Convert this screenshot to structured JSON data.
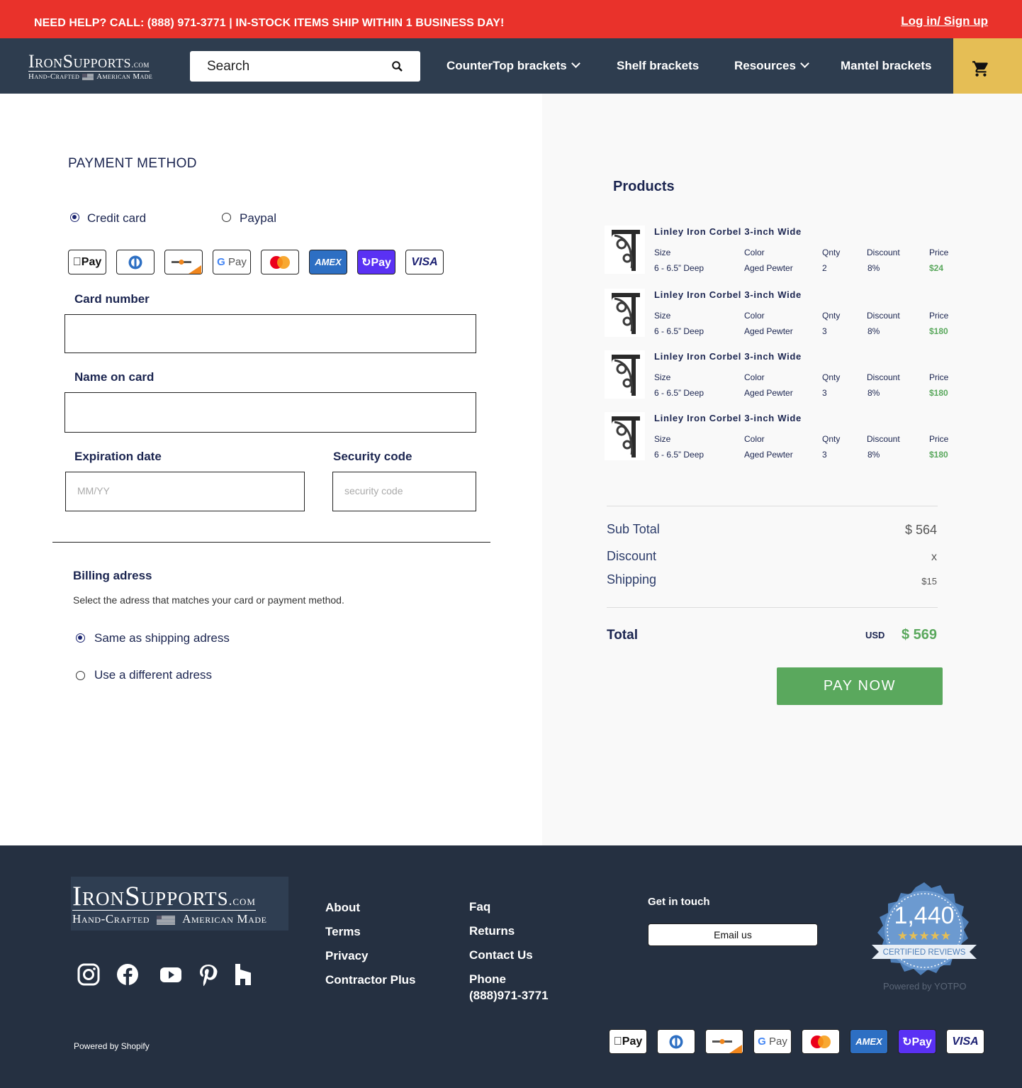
{
  "topbar": {
    "message": "NEED HELP? CALL: (888) 971-3771 | IN-STOCK ITEMS SHIP WITHIN 1 BUSINESS DAY!",
    "login": "Log in/ Sign up"
  },
  "logo": {
    "main": "IronSupports",
    "domain": ".com",
    "left": "Hand-Crafted",
    "right": "American Made"
  },
  "search": {
    "placeholder": "Search"
  },
  "nav": {
    "countertop": "CounterTop brackets",
    "shelf": "Shelf brackets",
    "resources": "Resources",
    "mantel": "Mantel brackets"
  },
  "payment": {
    "heading": "PAYMENT METHOD",
    "credit": "Credit card",
    "paypal": "Paypal",
    "selected": "Credit card",
    "cards": [
      "apple-pay-icon",
      "diners-club-icon",
      "discover-icon",
      "google-pay-icon",
      "mastercard-icon",
      "amex-icon",
      "shop-pay-icon",
      "visa-icon"
    ],
    "card_number_label": "Card number",
    "name_label": "Name on card",
    "exp_label": "Expiration date",
    "exp_placeholder": "MM/YY",
    "sec_label": "Security code",
    "sec_placeholder": "security code"
  },
  "billing": {
    "heading": "Billing adress",
    "sub": "Select the adress that matches your card or payment method.",
    "same": "Same as shipping adress",
    "different": "Use a different adress",
    "selected": "Same as shipping adress"
  },
  "products": {
    "heading": "Products",
    "headers": {
      "size": "Size",
      "color": "Color",
      "qty": "Qnty",
      "discount": "Discount",
      "price": "Price"
    },
    "items": [
      {
        "name": "Linley Iron Corbel 3-inch Wide",
        "size": "6 - 6.5” Deep",
        "color": "Aged Pewter",
        "qty": "2",
        "discount": "8%",
        "price": "$24"
      },
      {
        "name": "Linley Iron Corbel 3-inch Wide",
        "size": "6 - 6.5” Deep",
        "color": "Aged Pewter",
        "qty": "3",
        "discount": "8%",
        "price": "$180"
      },
      {
        "name": "Linley Iron Corbel 3-inch Wide",
        "size": "6 - 6.5” Deep",
        "color": "Aged Pewter",
        "qty": "3",
        "discount": "8%",
        "price": "$180"
      },
      {
        "name": "Linley Iron Corbel 3-inch Wide",
        "size": "6 - 6.5” Deep",
        "color": "Aged Pewter",
        "qty": "3",
        "discount": "8%",
        "price": "$180"
      }
    ]
  },
  "summary": {
    "subtotal_label": "Sub Total",
    "subtotal": "$ 564",
    "discount_label": "Discount",
    "discount": "x",
    "shipping_label": "Shipping",
    "shipping": "$15",
    "total_label": "Total",
    "currency": "USD",
    "total": "$ 569",
    "pay_button": "PAY NOW"
  },
  "footer": {
    "links_col1": [
      "About",
      "Terms",
      "Privacy",
      "Contractor Plus"
    ],
    "links_col2": [
      "Faq",
      "Returns",
      "Contact Us",
      "Phone"
    ],
    "phone": "(888)971-3771",
    "get_in_touch": "Get in touch",
    "email_button": "Email us",
    "reviews_count": "1,440",
    "reviews_label": "CERTIFIED REVIEWS",
    "powered_yotpo": "Powered by YOTPO",
    "powered_shopify": "Powered by Shopify",
    "social": [
      "instagram-icon",
      "facebook-icon",
      "youtube-icon",
      "pinterest-icon",
      "houzz-icon"
    ]
  },
  "colors": {
    "topbar": "#e9322b",
    "nav": "#2e3d4f",
    "cart": "#e5be55",
    "accent_green": "#5aa85d",
    "navy": "#1b2550",
    "footer": "#253041"
  }
}
